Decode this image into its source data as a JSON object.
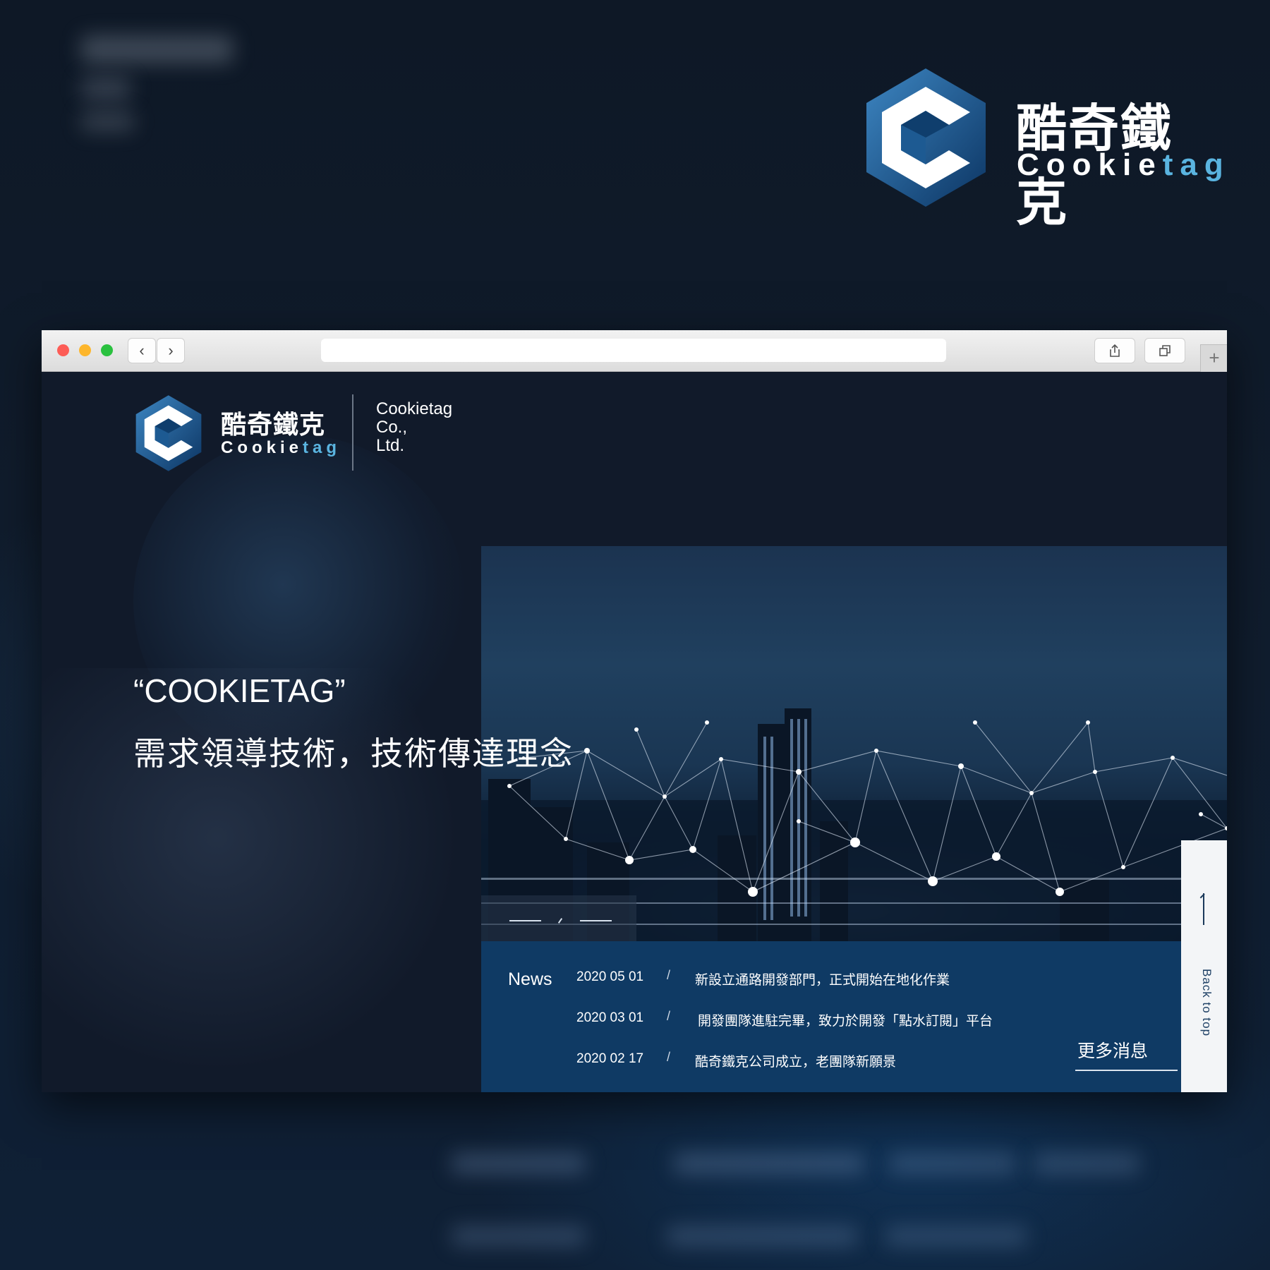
{
  "brand": {
    "zh_name": "酷奇鐵克",
    "en_name_main": "Cookie",
    "en_name_accent": "tag"
  },
  "site": {
    "logo_zh": "酷奇鐵克",
    "logo_en_main": "Cookie",
    "logo_en_accent": "tag",
    "company_line1": "Cookietag",
    "company_line2": "Co.,",
    "company_line3": "Ltd.",
    "hero_quote": "“COOKIETAG”",
    "hero_subtitle": "需求領導技術，技術傳達理念"
  },
  "news": {
    "title": "News",
    "items": [
      {
        "date": "2020 05 01",
        "sep": "/",
        "text": "新設立通路開發部門，正式開始在地化作業"
      },
      {
        "date": "2020 03 01",
        "sep": "/",
        "text": "開發團隊進駐完畢，致力於開發「點水訂閱」平台"
      },
      {
        "date": "2020 02 17",
        "sep": "/",
        "text": "酷奇鐵克公司成立，老團隊新願景"
      }
    ],
    "more_label": "更多消息"
  },
  "back_to_top": "Back to top",
  "colors": {
    "accent": "#5ab4e0",
    "news_bg": "#0f3a64",
    "page_bg": "#111a2a"
  }
}
